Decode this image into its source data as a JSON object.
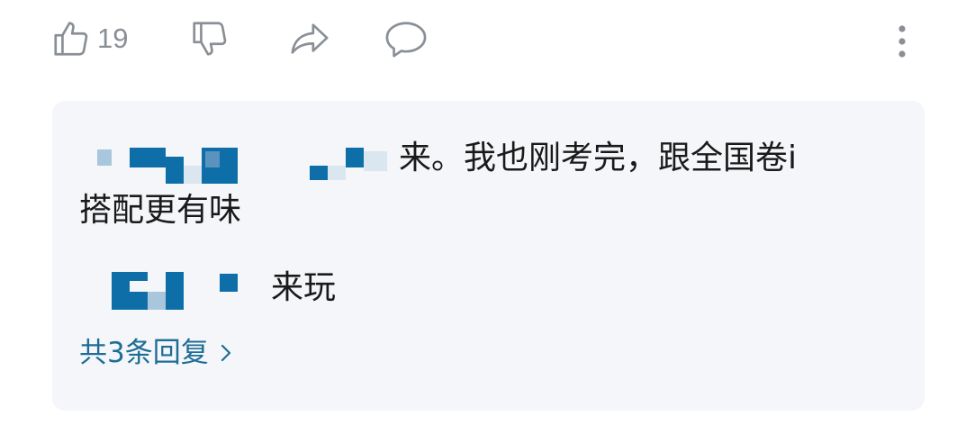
{
  "actions": {
    "like_count": "19",
    "icons": [
      "thumbs-up-icon",
      "thumbs-down-icon",
      "share-icon",
      "comment-icon",
      "more-vertical-icon"
    ]
  },
  "comment": {
    "line1": "来。我也刚考完，跟全国卷i",
    "line2": "搭配更有味",
    "reply_preview": "来玩",
    "view_replies": "共3条回复",
    "redacted_usernames": true
  },
  "colors": {
    "card_bg": "#f4f6f9",
    "link": "#1e6d96",
    "icon_gray": "#8a8f96",
    "mosaic_dark": "#0e6fa8",
    "mosaic_light": "#a9c7dc"
  }
}
